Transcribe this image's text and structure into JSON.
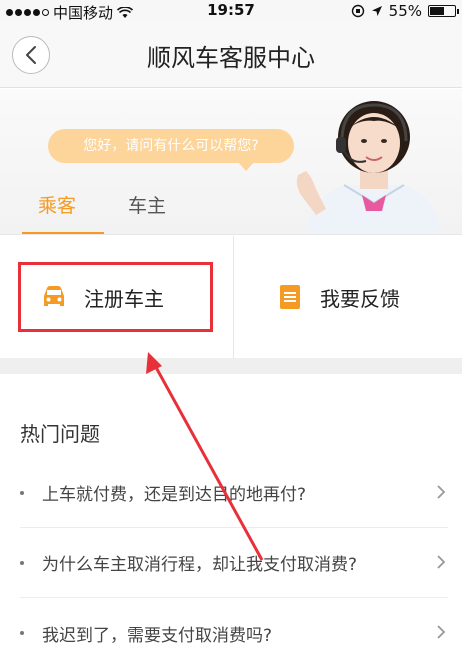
{
  "status_bar": {
    "carrier": "中国移动",
    "time": "19:57",
    "battery": "55%",
    "battery_level": 0.55
  },
  "header": {
    "title": "顺风车客服中心",
    "back_icon": "chevron-left-icon"
  },
  "banner": {
    "greeting": "您好，请问有什么可以帮您?",
    "tabs": [
      {
        "label": "乘客",
        "active": true
      },
      {
        "label": "车主",
        "active": false
      }
    ],
    "accent_color": "#f59a23"
  },
  "actions": [
    {
      "label": "注册车主",
      "icon": "car-icon"
    },
    {
      "label": "我要反馈",
      "icon": "document-icon"
    }
  ],
  "hot_questions": {
    "title": "热门问题",
    "items": [
      {
        "text": "上车就付费，还是到达目的地再付?"
      },
      {
        "text": "为什么车主取消行程，却让我支付取消费?"
      },
      {
        "text": "我迟到了，需要支付取消费吗?"
      }
    ]
  },
  "annotation_color": "#e8303a"
}
